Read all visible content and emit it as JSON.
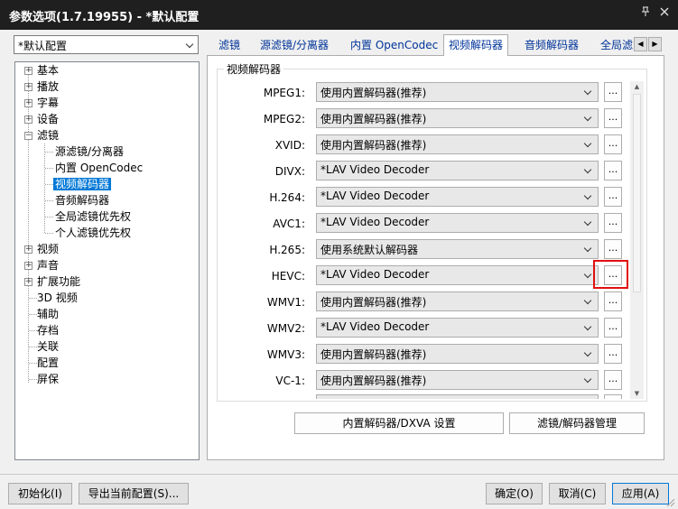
{
  "window": {
    "title": "参数选项(1.7.19955) - *默认配置",
    "pin_icon": "pin-icon",
    "close_icon": "close-icon"
  },
  "profile": {
    "selected": "*默认配置"
  },
  "tree": {
    "items": [
      {
        "label": "基本"
      },
      {
        "label": "播放"
      },
      {
        "label": "字幕"
      },
      {
        "label": "设备"
      },
      {
        "label": "滤镜"
      },
      {
        "label": "源滤镜/分离器"
      },
      {
        "label": "内置 OpenCodec"
      },
      {
        "label": "视频解码器"
      },
      {
        "label": "音频解码器"
      },
      {
        "label": "全局滤镜优先权"
      },
      {
        "label": "个人滤镜优先权"
      },
      {
        "label": "视频"
      },
      {
        "label": "声音"
      },
      {
        "label": "扩展功能"
      },
      {
        "label": "3D 视频"
      },
      {
        "label": "辅助"
      },
      {
        "label": "存档"
      },
      {
        "label": "关联"
      },
      {
        "label": "配置"
      },
      {
        "label": "屏保"
      }
    ]
  },
  "tabs": [
    {
      "label": "滤镜"
    },
    {
      "label": "源滤镜/分离器"
    },
    {
      "label": "内置 OpenCodec"
    },
    {
      "label": "视频解码器"
    },
    {
      "label": "音频解码器"
    },
    {
      "label": "全局滤"
    }
  ],
  "group": {
    "title": "视频解码器",
    "rows": [
      {
        "label": "MPEG1:",
        "value": "使用内置解码器(推荐)",
        "btn": "..."
      },
      {
        "label": "MPEG2:",
        "value": "使用内置解码器(推荐)",
        "btn": "..."
      },
      {
        "label": "XVID:",
        "value": "使用内置解码器(推荐)",
        "btn": "..."
      },
      {
        "label": "DIVX:",
        "value": "*LAV Video Decoder",
        "btn": "..."
      },
      {
        "label": "H.264:",
        "value": "*LAV Video Decoder",
        "btn": "..."
      },
      {
        "label": "AVC1:",
        "value": "*LAV Video Decoder",
        "btn": "..."
      },
      {
        "label": "H.265:",
        "value": "使用系统默认解码器",
        "btn": "..."
      },
      {
        "label": "HEVC:",
        "value": "*LAV Video Decoder",
        "btn": "..."
      },
      {
        "label": "WMV1:",
        "value": "使用内置解码器(推荐)",
        "btn": "..."
      },
      {
        "label": "WMV2:",
        "value": "*LAV Video Decoder",
        "btn": "..."
      },
      {
        "label": "WMV3:",
        "value": "使用内置解码器(推荐)",
        "btn": "..."
      },
      {
        "label": "VC-1:",
        "value": "使用内置解码器(推荐)",
        "btn": "..."
      }
    ]
  },
  "panel_buttons": {
    "dxva": "内置解码器/DXVA 设置",
    "manage": "滤镜/解码器管理"
  },
  "footer": {
    "init": "初始化(I)",
    "export": "导出当前配置(S)...",
    "ok": "确定(O)",
    "cancel": "取消(C)",
    "apply": "应用(A)"
  }
}
